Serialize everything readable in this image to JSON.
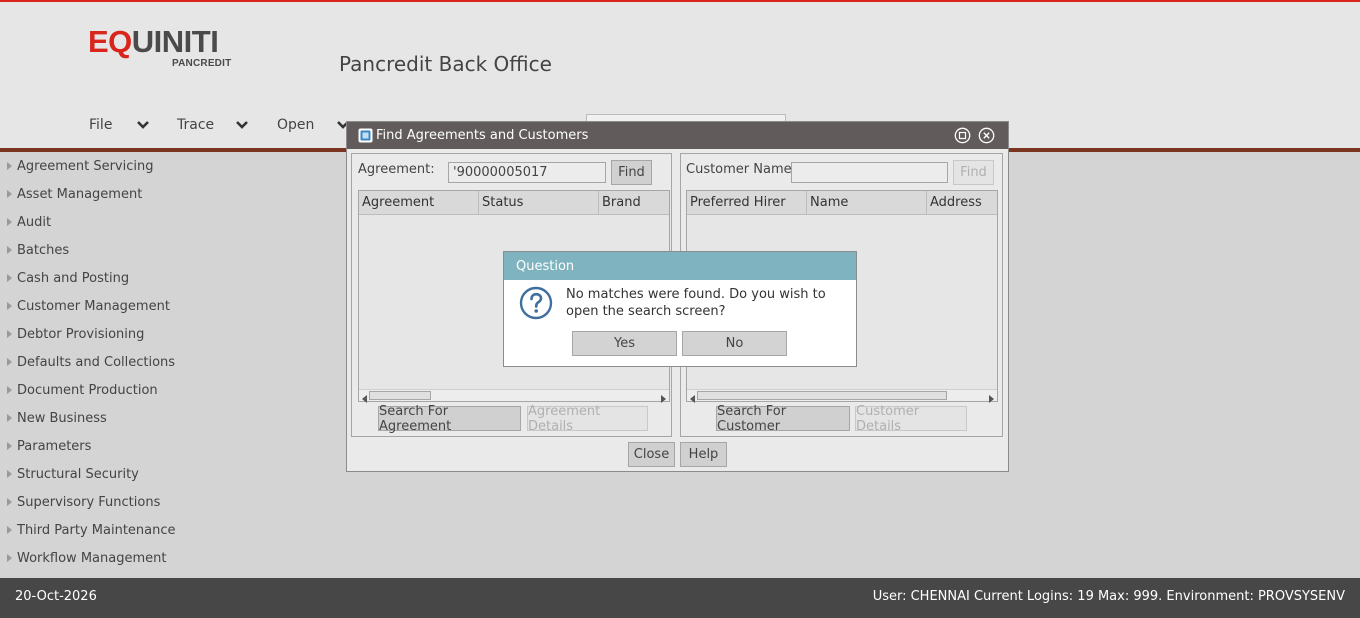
{
  "app": {
    "logo_main_red": "EQ",
    "logo_main_rest": "UINITI",
    "logo_sub": "PANCREDIT",
    "title": "Pancredit Back Office"
  },
  "menu": {
    "items": [
      {
        "label": "File"
      },
      {
        "label": "Trace"
      },
      {
        "label": "Open"
      }
    ]
  },
  "sidebar": {
    "items": [
      {
        "label": "Agreement Servicing"
      },
      {
        "label": "Asset Management"
      },
      {
        "label": "Audit"
      },
      {
        "label": "Batches"
      },
      {
        "label": "Cash and Posting"
      },
      {
        "label": "Customer Management"
      },
      {
        "label": "Debtor Provisioning"
      },
      {
        "label": "Defaults and Collections"
      },
      {
        "label": "Document Production"
      },
      {
        "label": "New Business"
      },
      {
        "label": "Parameters"
      },
      {
        "label": "Structural Security"
      },
      {
        "label": "Supervisory Functions"
      },
      {
        "label": "Third Party Maintenance"
      },
      {
        "label": "Workflow Management"
      }
    ]
  },
  "find_dialog": {
    "title": "Find Agreements and Customers",
    "agreement": {
      "label": "Agreement:",
      "value": "'90000005017",
      "find_label": "Find",
      "columns": [
        "Agreement",
        "Status",
        "Brand"
      ],
      "search_button": "Search For Agreement",
      "details_button": "Agreement Details"
    },
    "customer": {
      "label": "Customer Name:",
      "value": "",
      "find_label": "Find",
      "columns": [
        "Preferred Hirer",
        "Name",
        "Address"
      ],
      "search_button": "Search For Customer",
      "details_button": "Customer Details"
    },
    "close_label": "Close",
    "help_label": "Help"
  },
  "question": {
    "title": "Question",
    "message": "No matches were found.  Do you wish to open the search screen?",
    "yes_label": "Yes",
    "no_label": "No"
  },
  "footer": {
    "date": "20-Oct-2026",
    "info": "User: CHENNAI  Current Logins: 19  Max: 999.  Environment: PROVSYSENV"
  },
  "colors": {
    "accent_red": "#d9251c",
    "brand_bar": "#7a3520",
    "dialog_title": "#615b5c",
    "question_title": "#7eb3bf",
    "footer": "#474747"
  },
  "icons": {
    "menu_chevron": "chevron-down-icon",
    "sidebar_bullet": "triangle-right-icon",
    "dialog_app": "app-window-icon",
    "maximize": "maximize-icon",
    "close": "close-icon",
    "question": "question-mark-icon"
  }
}
